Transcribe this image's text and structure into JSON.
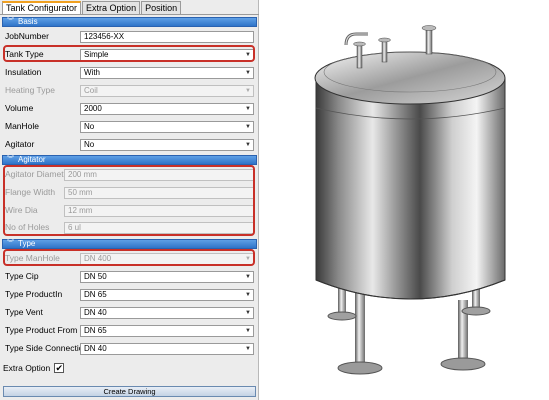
{
  "tabs": [
    "Tank Configurator",
    "Extra Option",
    "Position"
  ],
  "sections": {
    "basis": "Basis",
    "agitator": "Agitator",
    "type": "Type"
  },
  "basis": [
    {
      "label": "JobNumber",
      "value": "123456-XX",
      "kind": "text",
      "enabled": true
    },
    {
      "label": "Tank Type",
      "value": "Simple",
      "kind": "select",
      "enabled": true
    },
    {
      "label": "Insulation",
      "value": "With",
      "kind": "select",
      "enabled": true
    },
    {
      "label": "Heating Type",
      "value": "Coil",
      "kind": "select",
      "enabled": false
    },
    {
      "label": "Volume",
      "value": "2000",
      "kind": "select",
      "enabled": true
    },
    {
      "label": "ManHole",
      "value": "No",
      "kind": "select",
      "enabled": true
    },
    {
      "label": "Agitator",
      "value": "No",
      "kind": "select",
      "enabled": true
    }
  ],
  "agitator": [
    {
      "label": "Agitator Diameter",
      "value": "200 mm",
      "enabled": false
    },
    {
      "label": "Flange Width",
      "value": "50 mm",
      "enabled": false
    },
    {
      "label": "Wire Dia",
      "value": "12 mm",
      "enabled": false
    },
    {
      "label": "No of Holes",
      "value": "6 ul",
      "enabled": false
    }
  ],
  "type": [
    {
      "label": "Type ManHole",
      "value": "DN 400",
      "enabled": false
    },
    {
      "label": "Type Cip",
      "value": "DN 50",
      "enabled": true
    },
    {
      "label": "Type ProductIn",
      "value": "DN 65",
      "enabled": true
    },
    {
      "label": "Type Vent",
      "value": "DN 40",
      "enabled": true
    },
    {
      "label": "Type Product From",
      "value": "DN 65",
      "enabled": true
    },
    {
      "label": "Type Side Connection",
      "value": "DN 40",
      "enabled": true
    }
  ],
  "extra_option": {
    "label": "Extra Option",
    "checked": true,
    "check_glyph": "✔"
  },
  "create_button": "Create Drawing",
  "colors": {
    "section": "#2f74c8",
    "highlight": "#c83028",
    "active_tab": "#f0a020"
  }
}
